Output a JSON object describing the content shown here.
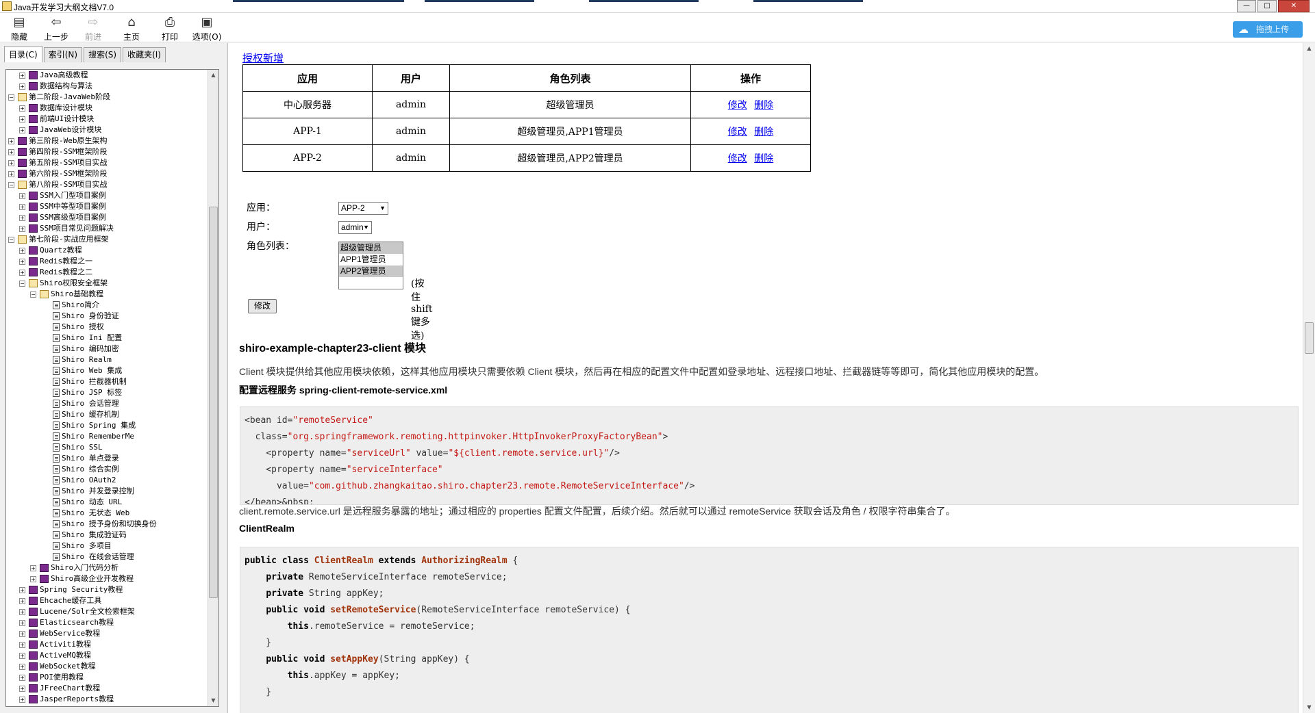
{
  "window": {
    "title": "Java开发学习大纲文档V7.0",
    "buttons": {
      "minimize": "—",
      "maximize": "□",
      "close": "✕"
    }
  },
  "toolbar": {
    "hide": "隐藏",
    "back": "上一步",
    "forward": "前进",
    "home": "主页",
    "print": "打印",
    "options": "选项(O)",
    "upload": "拖拽上传"
  },
  "left_tabs": [
    "目录(C)",
    "索引(N)",
    "搜索(S)",
    "收藏夹(I)"
  ],
  "tree": [
    {
      "level": 2,
      "type": "book",
      "expand": "+",
      "text": "Java高级教程"
    },
    {
      "level": 2,
      "type": "book",
      "expand": "+",
      "text": "数据结构与算法"
    },
    {
      "level": 1,
      "type": "open",
      "expand": "−",
      "text": "第二阶段-JavaWeb阶段"
    },
    {
      "level": 2,
      "type": "book",
      "expand": "+",
      "text": "数据库设计模块"
    },
    {
      "level": 2,
      "type": "book",
      "expand": "+",
      "text": "前端UI设计模块"
    },
    {
      "level": 2,
      "type": "book",
      "expand": "+",
      "text": "JavaWeb设计模块"
    },
    {
      "level": 1,
      "type": "book",
      "expand": "+",
      "text": "第三阶段-Web原生架构"
    },
    {
      "level": 1,
      "type": "book",
      "expand": "+",
      "text": "第四阶段-SSM框架阶段"
    },
    {
      "level": 1,
      "type": "book",
      "expand": "+",
      "text": "第五阶段-SSM项目实战"
    },
    {
      "level": 1,
      "type": "book",
      "expand": "+",
      "text": "第六阶段-SSM框架阶段"
    },
    {
      "level": 1,
      "type": "open",
      "expand": "−",
      "text": "第八阶段-SSM项目实战"
    },
    {
      "level": 2,
      "type": "book",
      "expand": "+",
      "text": "SSM入门型项目案例"
    },
    {
      "level": 2,
      "type": "book",
      "expand": "+",
      "text": "SSM中等型项目案例"
    },
    {
      "level": 2,
      "type": "book",
      "expand": "+",
      "text": "SSM高级型项目案例"
    },
    {
      "level": 2,
      "type": "book",
      "expand": "+",
      "text": "SSM项目常见问题解决"
    },
    {
      "level": 1,
      "type": "open",
      "expand": "−",
      "text": "第七阶段-实战应用框架"
    },
    {
      "level": 2,
      "type": "book",
      "expand": "+",
      "text": "Quartz教程"
    },
    {
      "level": 2,
      "type": "book",
      "expand": "+",
      "text": "Redis教程之一"
    },
    {
      "level": 2,
      "type": "book",
      "expand": "+",
      "text": "Redis教程之二"
    },
    {
      "level": 2,
      "type": "open",
      "expand": "−",
      "text": "Shiro权限安全框架"
    },
    {
      "level": 3,
      "type": "open",
      "expand": "−",
      "text": "Shiro基础教程"
    },
    {
      "level": 4,
      "type": "page",
      "text": "Shiro简介"
    },
    {
      "level": 4,
      "type": "page",
      "text": "Shiro 身份验证"
    },
    {
      "level": 4,
      "type": "page",
      "text": "Shiro 授权"
    },
    {
      "level": 4,
      "type": "page",
      "text": "Shiro Ini 配置"
    },
    {
      "level": 4,
      "type": "page",
      "text": "Shiro 编码加密"
    },
    {
      "level": 4,
      "type": "page",
      "text": "Shiro Realm"
    },
    {
      "level": 4,
      "type": "page",
      "text": "Shiro Web 集成"
    },
    {
      "level": 4,
      "type": "page",
      "text": "Shiro 拦截器机制"
    },
    {
      "level": 4,
      "type": "page",
      "text": "Shiro JSP 标签"
    },
    {
      "level": 4,
      "type": "page",
      "text": "Shiro 会话管理"
    },
    {
      "level": 4,
      "type": "page",
      "text": "Shiro 缓存机制"
    },
    {
      "level": 4,
      "type": "page",
      "text": "Shiro Spring 集成"
    },
    {
      "level": 4,
      "type": "page",
      "text": "Shiro RememberMe"
    },
    {
      "level": 4,
      "type": "page",
      "text": "Shiro SSL"
    },
    {
      "level": 4,
      "type": "page",
      "text": "Shiro 单点登录"
    },
    {
      "level": 4,
      "type": "page",
      "text": "Shiro 综合实例"
    },
    {
      "level": 4,
      "type": "page",
      "text": "Shiro OAuth2"
    },
    {
      "level": 4,
      "type": "page",
      "text": "Shiro 并发登录控制"
    },
    {
      "level": 4,
      "type": "page",
      "text": "Shiro 动态 URL"
    },
    {
      "level": 4,
      "type": "page",
      "text": "Shiro 无状态 Web"
    },
    {
      "level": 4,
      "type": "page",
      "text": "Shiro 授予身份和切换身份"
    },
    {
      "level": 4,
      "type": "page",
      "text": "Shiro 集成验证码"
    },
    {
      "level": 4,
      "type": "page",
      "text": "Shiro 多项目"
    },
    {
      "level": 4,
      "type": "page",
      "text": "Shiro 在线会话管理"
    },
    {
      "level": 3,
      "type": "book",
      "expand": "+",
      "text": "Shiro入门代码分析"
    },
    {
      "level": 3,
      "type": "book",
      "expand": "+",
      "text": "Shiro高级企业开发教程"
    },
    {
      "level": 2,
      "type": "book",
      "expand": "+",
      "text": "Spring Security教程"
    },
    {
      "level": 2,
      "type": "book",
      "expand": "+",
      "text": "Ehcache缓存工具"
    },
    {
      "level": 2,
      "type": "book",
      "expand": "+",
      "text": "Lucene/Solr全文检索框架"
    },
    {
      "level": 2,
      "type": "book",
      "expand": "+",
      "text": "Elasticsearch教程"
    },
    {
      "level": 2,
      "type": "book",
      "expand": "+",
      "text": "WebService教程"
    },
    {
      "level": 2,
      "type": "book",
      "expand": "+",
      "text": "Activiti教程"
    },
    {
      "level": 2,
      "type": "book",
      "expand": "+",
      "text": "ActiveMQ教程"
    },
    {
      "level": 2,
      "type": "book",
      "expand": "+",
      "text": "WebSocket教程"
    },
    {
      "level": 2,
      "type": "book",
      "expand": "+",
      "text": "POI使用教程"
    },
    {
      "level": 2,
      "type": "book",
      "expand": "+",
      "text": "JFreeChart教程"
    },
    {
      "level": 2,
      "type": "book",
      "expand": "+",
      "text": "JasperReports教程"
    }
  ],
  "content": {
    "auth_link": "授权新增",
    "table": {
      "headers": [
        "应用",
        "用户",
        "角色列表",
        "操作"
      ],
      "rows": [
        {
          "app": "中心服务器",
          "user": "admin",
          "roles": "超级管理员",
          "edit": "修改",
          "del": "删除"
        },
        {
          "app": "APP-1",
          "user": "admin",
          "roles": "超级管理员,APP1管理员",
          "edit": "修改",
          "del": "删除"
        },
        {
          "app": "APP-2",
          "user": "admin",
          "roles": "超级管理员,APP2管理员",
          "edit": "修改",
          "del": "删除"
        }
      ]
    },
    "form": {
      "app_label": "应用：",
      "app_value": "APP-2",
      "user_label": "用户：",
      "user_value": "admin",
      "roles_label": "角色列表：",
      "role_options": [
        "超级管理员",
        "APP1管理员",
        "APP2管理员"
      ],
      "hint": "(按住shift键多选)",
      "submit": "修改"
    },
    "section_title": "shiro-example-chapter23-client 模块",
    "para1": "Client 模块提供给其他应用模块依赖，这样其他应用模块只需要依赖  Client 模块，然后再在相应的配置文件中配置如登录地址、远程接口地址、拦截器链等等即可，简化其他应用模块的配置。",
    "sub1": "配置远程服务  spring-client-remote-service.xml",
    "para2": "client.remote.service.url 是远程服务暴露的地址；通过相应的  properties 配置文件配置，后续介绍。然后就可以通过  remoteService 获取会话及角色 / 权限字符串集合了。",
    "sub2": "ClientRealm"
  }
}
